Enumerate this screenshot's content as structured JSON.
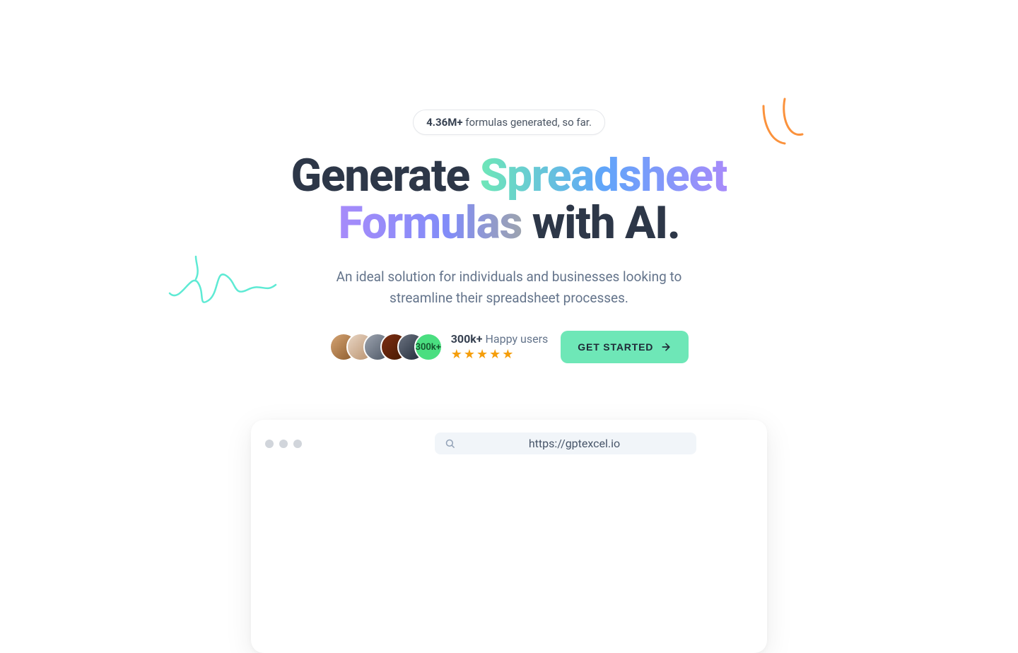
{
  "badge": {
    "count": "4.36M+",
    "suffix": " formulas generated, so far."
  },
  "headline": {
    "part1": "Generate ",
    "part2": "Spreadsheet",
    "part3": "Formulas",
    "part4": " with AI."
  },
  "subtitle": "An ideal solution for individuals and businesses looking to streamline their spreadsheet processes.",
  "users": {
    "badge_text": "300k+",
    "count": "300k+",
    "label": " Happy users"
  },
  "cta": {
    "label": "GET STARTED"
  },
  "browser": {
    "url": "https://gptexcel.io"
  },
  "colors": {
    "accent": "#6ee7b7",
    "star": "#f59e0b"
  }
}
